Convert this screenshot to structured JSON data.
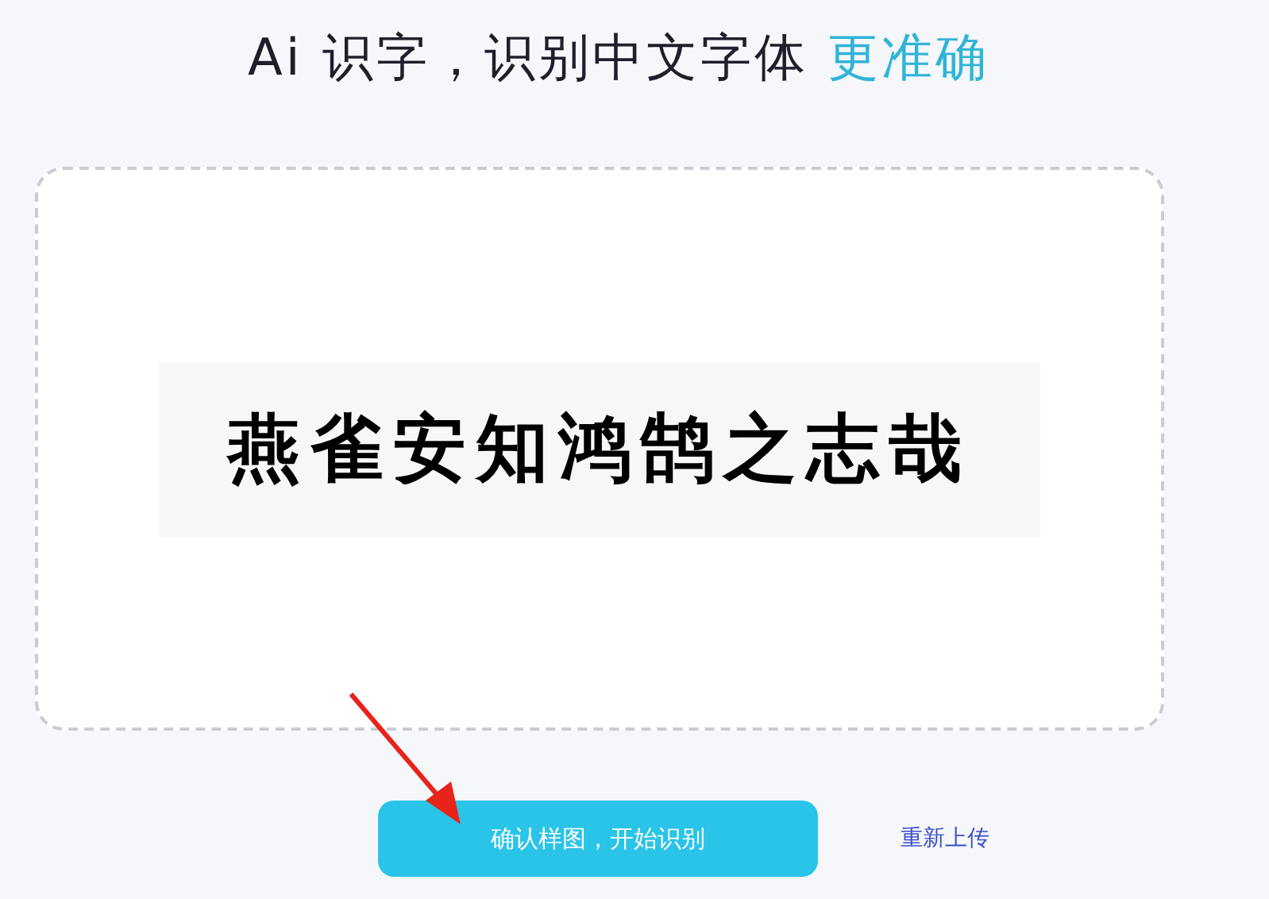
{
  "heading": {
    "text": "Ai 识字，识别中文字体",
    "highlight": "更准确"
  },
  "upload": {
    "sample_text": "燕雀安知鸿鹄之志哉"
  },
  "buttons": [
    {
      "label": "确认样图，开始识别",
      "kind": "primary"
    },
    {
      "label": "重新上传",
      "kind": "link"
    }
  ]
}
